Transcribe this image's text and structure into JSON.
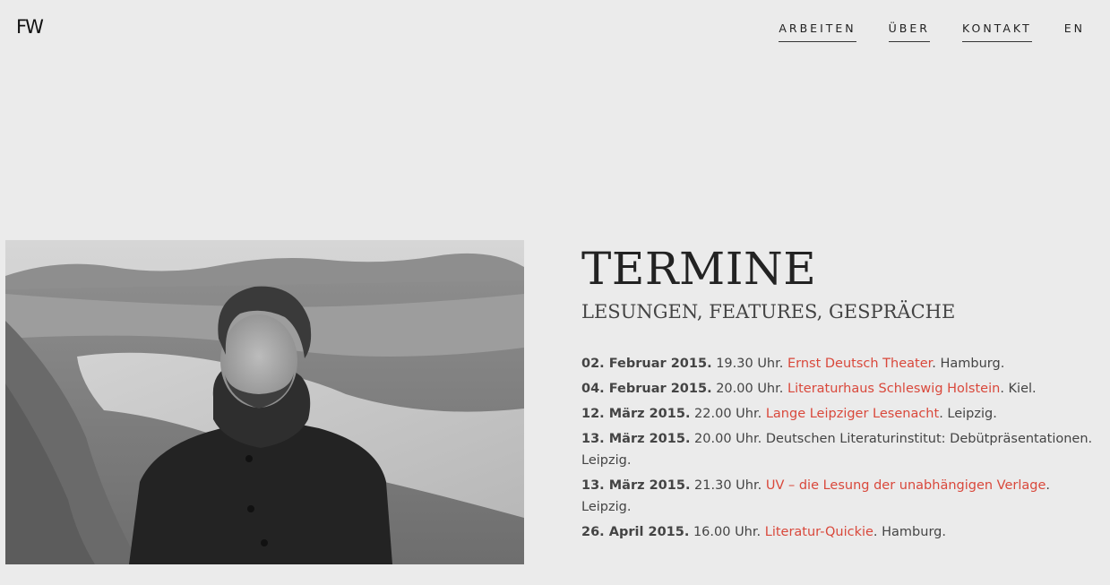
{
  "header": {
    "logo": "FW",
    "nav": [
      {
        "label": "ARBEITEN"
      },
      {
        "label": "ÜBER"
      },
      {
        "label": "KONTAKT"
      },
      {
        "label": "EN"
      }
    ]
  },
  "main": {
    "title": "TERMINE",
    "subtitle": "LESUNGEN, FEATURES, GESPRÄCHE",
    "events": [
      {
        "date": "02. Februar 2015.",
        "time": " 19.30 Uhr. ",
        "venue": "Ernst Deutsch Theater",
        "venue_linked": true,
        "city": ". Hamburg."
      },
      {
        "date": "04. Februar 2015.",
        "time": " 20.00 Uhr. ",
        "venue": "Literaturhaus Schleswig Holstein",
        "venue_linked": true,
        "city": ". Kiel."
      },
      {
        "date": "12. März 2015.",
        "time": " 22.00 Uhr. ",
        "venue": "Lange Leipziger Lesenacht",
        "venue_linked": true,
        "city": ". Leipzig."
      },
      {
        "date": "13. März 2015.",
        "time": " 20.00 Uhr. ",
        "venue": "Deutschen Literaturinstitut: Debütpräsentationen",
        "venue_linked": false,
        "city": ". Leipzig."
      },
      {
        "date": "13. März 2015.",
        "time": " 21.30 Uhr. ",
        "venue": "UV – die Lesung der unabhängigen Verlage",
        "venue_linked": true,
        "city": ". Leipzig."
      },
      {
        "date": "26. April 2015.",
        "time": " 16.00 Uhr. ",
        "venue": "Literatur-Quickie",
        "venue_linked": true,
        "city": ". Hamburg."
      }
    ]
  },
  "colors": {
    "background": "#ebebeb",
    "link": "#d9483b",
    "text": "#444444"
  }
}
